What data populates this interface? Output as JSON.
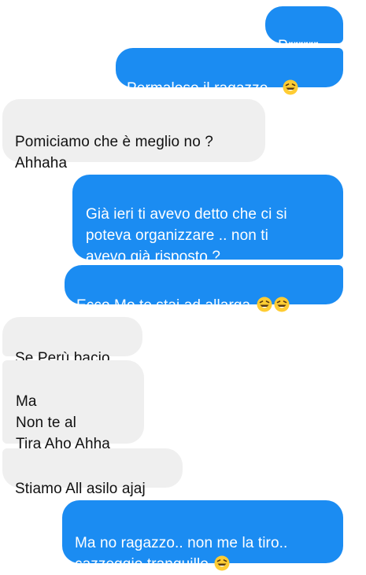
{
  "messages": [
    {
      "text": "Prrrrrr",
      "emoji": []
    },
    {
      "text": "Permaloso il ragazzo.. ",
      "emoji": [
        "laughing-emoji"
      ]
    },
    {
      "text": "Pomiciamo che è meglio no ?\nAhhaha",
      "emoji": []
    },
    {
      "text": "Già ieri ti avevo detto che ci si\npoteva organizzare .. non ti\navevo già risposto ?",
      "emoji": []
    },
    {
      "text": "Ecco Mo te stai ad allarga ",
      "emoji": [
        "laughing-emoji",
        "laughing-emoji"
      ]
    },
    {
      "text": "Se Perù bacio",
      "emoji": []
    },
    {
      "text": "Ma\nNon te al\nTira Aho Ahha",
      "emoji": []
    },
    {
      "text": "Stiamo All asilo ajaj",
      "emoji": []
    },
    {
      "text": "Ma no ragazzo.. non me la tiro..\ncazzeggio tranquillo ",
      "emoji": [
        "laughing-emoji"
      ]
    }
  ],
  "colors": {
    "outgoing_bubble": "#1b8cf2",
    "incoming_bubble": "#efefef",
    "emoji_face": "#ffcc33"
  }
}
